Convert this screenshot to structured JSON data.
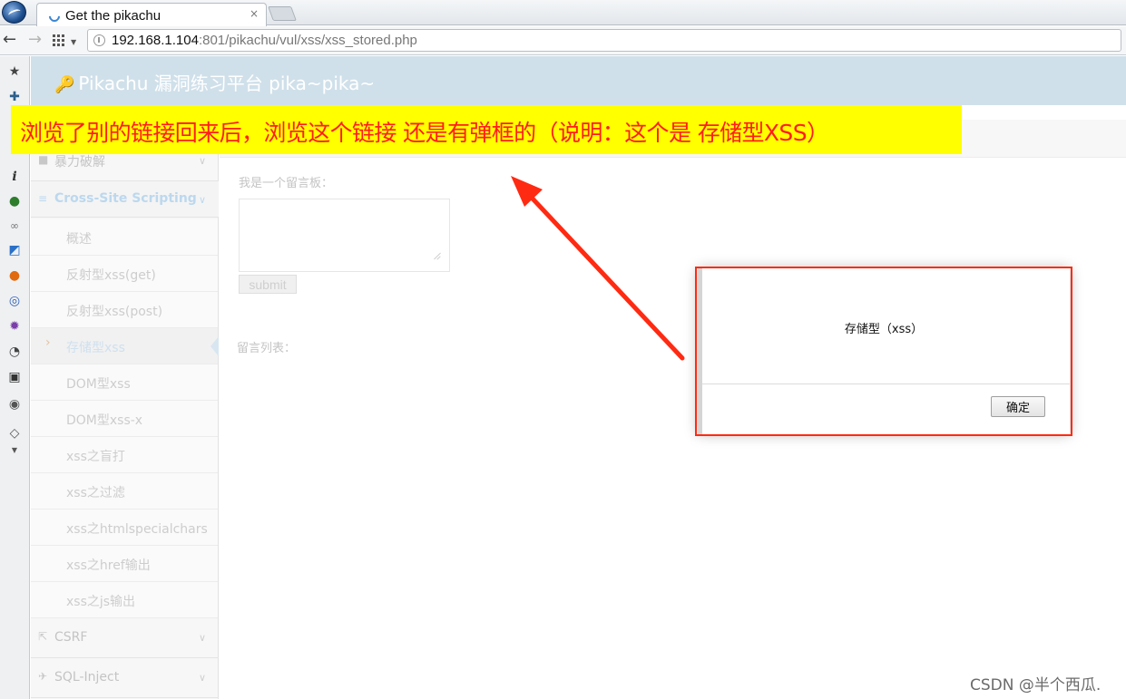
{
  "browser": {
    "tab_title": "Get the pikachu",
    "tab_close": "×",
    "url_host": "192.168.1.104",
    "url_rest": ":801/pikachu/vul/xss/xss_stored.php"
  },
  "extensions": [
    "star-icon",
    "puzzle-icon",
    "info-icon",
    "green-ball-icon",
    "link-icon",
    "cursor-icon",
    "firefox-icon",
    "swirl-icon",
    "gear-purple-icon",
    "palette-icon",
    "window-icon",
    "globe-icon",
    "tag-icon"
  ],
  "header": {
    "brand": "Pikachu 漏洞练习平台 pika~pika~"
  },
  "sidebar": {
    "brute_force": "暴力破解",
    "xss": "Cross-Site Scripting",
    "items": [
      "概述",
      "反射型xss(get)",
      "反射型xss(post)",
      "存储型xss",
      "DOM型xss",
      "DOM型xss-x",
      "xss之盲打",
      "xss之过滤",
      "xss之htmlspecialchars",
      "xss之href输出",
      "xss之js输出"
    ],
    "csrf": "CSRF",
    "sqli": "SQL-Inject"
  },
  "main": {
    "message_label": "我是一个留言板：",
    "submit_label": "submit",
    "list_label": "留言列表："
  },
  "dialog": {
    "message": "存储型（xss）",
    "ok_label": "确定"
  },
  "annotation": {
    "text": "浏览了别的链接回来后，浏览这个链接 还是有弹框的（说明：这个是 存储型XSS）",
    "color": "#ff1d1d",
    "background": "#ffff00"
  },
  "watermark": "CSDN @半个西瓜."
}
